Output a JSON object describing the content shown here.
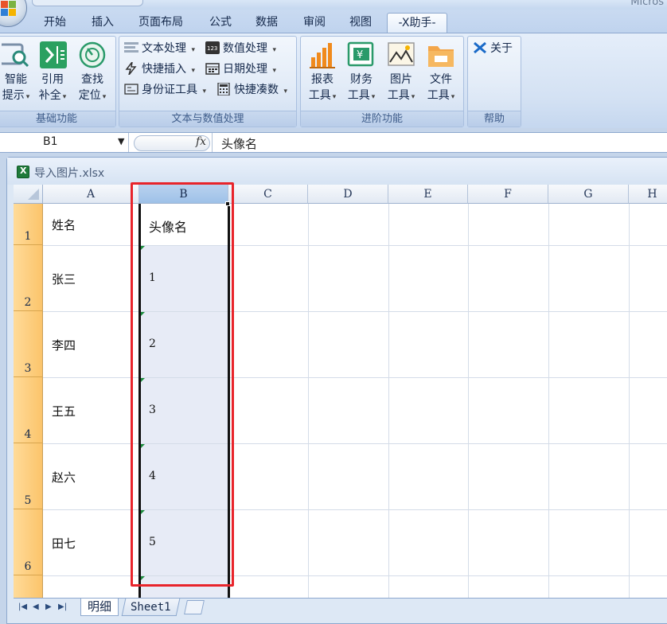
{
  "app": {
    "title": "Micros"
  },
  "tabs": [
    {
      "label": "开始"
    },
    {
      "label": "插入"
    },
    {
      "label": "页面布局"
    },
    {
      "label": "公式"
    },
    {
      "label": "数据"
    },
    {
      "label": "审阅"
    },
    {
      "label": "视图"
    },
    {
      "label": "-X助手-",
      "active": true
    }
  ],
  "ribbon": {
    "groups": [
      {
        "label": "基础功能",
        "buttons": [
          {
            "l1": "智能",
            "l2": "提示",
            "icon": "magnifier-icon"
          },
          {
            "l1": "引用",
            "l2": "补全",
            "icon": "arrow-fill-icon"
          },
          {
            "l1": "查找",
            "l2": "定位",
            "icon": "target-icon"
          }
        ]
      },
      {
        "label": "文本与数值处理",
        "buttons": [
          {
            "label": "文本处理",
            "icon": "text-lines-icon"
          },
          {
            "label": "数值处理",
            "icon": "number-123-icon"
          },
          {
            "label": "快捷插入",
            "icon": "lightning-icon"
          },
          {
            "label": "日期处理",
            "icon": "calendar-icon"
          },
          {
            "label": "身份证工具",
            "icon": "id-card-icon"
          },
          {
            "label": "快捷凑数",
            "icon": "calculator-icon"
          }
        ]
      },
      {
        "label": "进阶功能",
        "buttons": [
          {
            "l1": "报表",
            "l2": "工具",
            "icon": "bar-chart-icon"
          },
          {
            "l1": "财务",
            "l2": "工具",
            "icon": "finance-yen-icon"
          },
          {
            "l1": "图片",
            "l2": "工具",
            "icon": "picture-icon"
          },
          {
            "l1": "文件",
            "l2": "工具",
            "icon": "folder-icon"
          }
        ]
      },
      {
        "label": "帮助",
        "buttons": [
          {
            "label": "关于",
            "icon": "x-logo-icon"
          }
        ]
      }
    ]
  },
  "formula": {
    "namebox": "B1",
    "fx": "fx",
    "value": "头像名"
  },
  "workbook": {
    "filename": "导入图片.xlsx"
  },
  "grid": {
    "columns": [
      "A",
      "B",
      "C",
      "D",
      "E",
      "F",
      "G",
      "H"
    ],
    "rows": [
      "1",
      "2",
      "3",
      "4",
      "5",
      "6"
    ],
    "cells": {
      "A": [
        "姓名",
        "张三",
        "李四",
        "王五",
        "赵六",
        "田七"
      ],
      "B": [
        "头像名",
        "1",
        "2",
        "3",
        "4",
        "5"
      ]
    },
    "selected_column": "B"
  },
  "sheets": {
    "tabs": [
      "明细",
      "Sheet1"
    ],
    "active": "明细"
  },
  "colors": {
    "highlight_box": "#e8242b",
    "selected_header": "#9ec1e8",
    "row_header": "#fbc46b"
  }
}
